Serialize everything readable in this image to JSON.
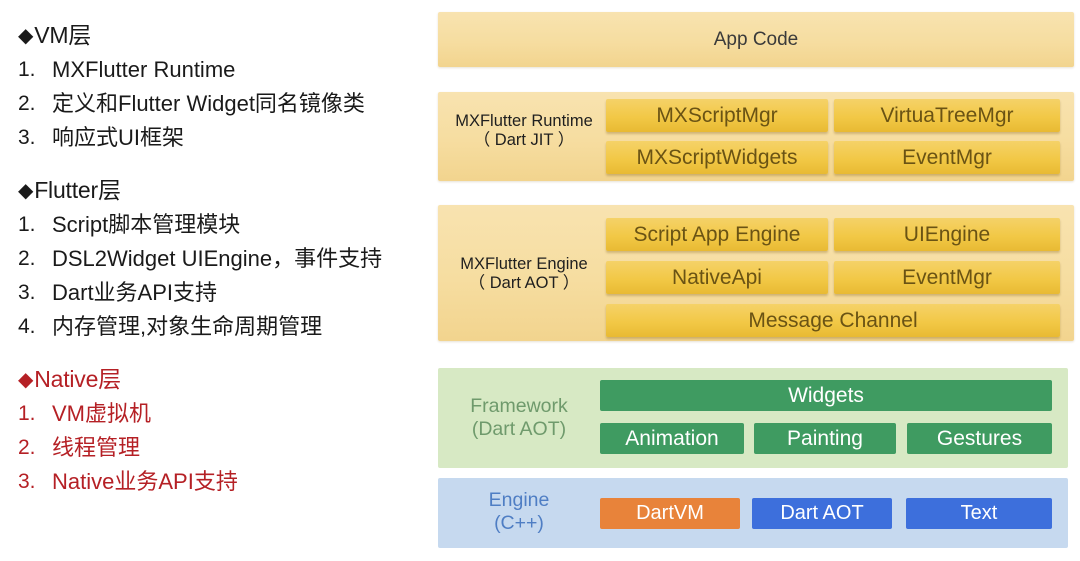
{
  "left": {
    "groups": [
      {
        "bullet": "◆",
        "title": "VM层",
        "color": "#1a1a1a",
        "items": [
          {
            "num": "1.",
            "text": "MXFlutter Runtime"
          },
          {
            "num": "2.",
            "text": "定义和Flutter Widget同名镜像类"
          },
          {
            "num": "3.",
            "text": "响应式UI框架"
          }
        ]
      },
      {
        "bullet": "◆",
        "title": "Flutter层",
        "color": "#1a1a1a",
        "items": [
          {
            "num": "1.",
            "text": "Script脚本管理模块"
          },
          {
            "num": "2.",
            "text": "DSL2Widget UIEngine，事件支持"
          },
          {
            "num": "3.",
            "text": "Dart业务API支持"
          },
          {
            "num": "4.",
            "text": "内存管理,对象生命周期管理"
          }
        ]
      },
      {
        "bullet": "◆",
        "title": "Native层",
        "color": "#b52025",
        "items": [
          {
            "num": "1.",
            "text": "VM虚拟机"
          },
          {
            "num": "2.",
            "text": "线程管理"
          },
          {
            "num": "3.",
            "text": "Native业务API支持"
          }
        ]
      }
    ]
  },
  "diagram": {
    "colors": {
      "gold_band": "#f6dda0",
      "gold_cell": "#f2c846",
      "green_band": "#d7e9c4",
      "green_cell": "#3f9b61",
      "blue_band": "#c6d9ef",
      "blue_cell": "#3d6fdc",
      "orange_cell": "#e8833a",
      "native_red": "#b52025"
    },
    "app_code": {
      "label": "App Code"
    },
    "runtime": {
      "label_line1": "MXFlutter Runtime",
      "label_line2": "（ Dart JIT ）",
      "cells": [
        "MXScriptMgr",
        "VirtuaTreeMgr",
        "MXScriptWidgets",
        "EventMgr"
      ]
    },
    "engine": {
      "label_line1": "MXFlutter Engine",
      "label_line2": "（ Dart AOT ）",
      "cells": [
        "Script App Engine",
        "UIEngine",
        "NativeApi",
        "EventMgr",
        "Message Channel"
      ]
    },
    "framework": {
      "label_line1": "Framework",
      "label_line2": "(Dart AOT)",
      "cells": [
        "Widgets",
        "Animation",
        "Painting",
        "Gestures"
      ]
    },
    "engine_native": {
      "label_line1": "Engine",
      "label_line2": "(C++)",
      "cells": [
        "DartVM",
        "Dart AOT",
        "Text"
      ]
    }
  }
}
